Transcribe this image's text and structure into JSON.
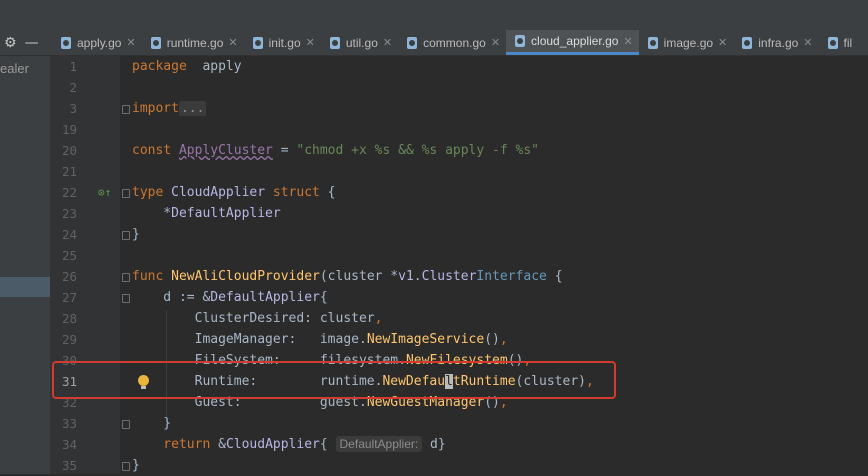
{
  "tabs": [
    {
      "label": "apply.go",
      "active": false
    },
    {
      "label": "runtime.go",
      "active": false
    },
    {
      "label": "init.go",
      "active": false
    },
    {
      "label": "util.go",
      "active": false
    },
    {
      "label": "common.go",
      "active": false
    },
    {
      "label": "cloud_applier.go",
      "active": true
    },
    {
      "label": "image.go",
      "active": false
    },
    {
      "label": "infra.go",
      "active": false
    },
    {
      "label": "fil",
      "active": false
    }
  ],
  "sidebar": {
    "fragment": "ealer"
  },
  "editor": {
    "lines": [
      {
        "num": "1",
        "segments": [
          [
            "kw",
            "package"
          ],
          [
            "",
            "  apply"
          ]
        ]
      },
      {
        "num": "2",
        "segments": []
      },
      {
        "num": "3",
        "fold": true,
        "segments": [
          [
            "kw",
            "import"
          ],
          [
            "",
            ""
          ],
          [
            "foldtxt",
            "..."
          ]
        ]
      },
      {
        "num": "19",
        "segments": []
      },
      {
        "num": "20",
        "segments": [
          [
            "kw",
            "const"
          ],
          [
            "",
            " "
          ],
          [
            "cst",
            "ApplyCluster"
          ],
          [
            "",
            " = "
          ],
          [
            "str",
            "\"chmod +x %s && %s apply -f %s\""
          ]
        ]
      },
      {
        "num": "21",
        "segments": []
      },
      {
        "num": "22",
        "fold": true,
        "impl": "⊙↑",
        "segments": [
          [
            "kw",
            "type"
          ],
          [
            "",
            " "
          ],
          [
            "typ",
            "CloudApplier"
          ],
          [
            "",
            " "
          ],
          [
            "kw",
            "struct"
          ],
          [
            "",
            " {"
          ]
        ]
      },
      {
        "num": "23",
        "segments": [
          [
            "",
            "    *"
          ],
          [
            "typ",
            "DefaultApplier"
          ]
        ]
      },
      {
        "num": "24",
        "fold": true,
        "segments": [
          [
            "",
            "}"
          ]
        ]
      },
      {
        "num": "25",
        "segments": []
      },
      {
        "num": "26",
        "fold": true,
        "segments": [
          [
            "kw",
            "func"
          ],
          [
            "",
            " "
          ],
          [
            "fn",
            "NewAliCloudProvider"
          ],
          [
            "",
            "(cluster *"
          ],
          [
            "typ",
            "v1"
          ],
          [
            "",
            "."
          ],
          [
            "typ",
            "Cluster"
          ],
          [
            ") "
          ],
          [
            "iface",
            "Interface"
          ],
          [
            "",
            " {"
          ]
        ]
      },
      {
        "num": "27",
        "fold": true,
        "segments": [
          [
            "",
            "    d := &"
          ],
          [
            "typ",
            "DefaultApplier"
          ],
          [
            "",
            "{"
          ]
        ]
      },
      {
        "num": "28",
        "segments": [
          [
            "",
            "        ClusterDesired: cluster"
          ],
          [
            "kw",
            ","
          ]
        ]
      },
      {
        "num": "29",
        "segments": [
          [
            "",
            "        ImageManager:   image."
          ],
          [
            "fn",
            "NewImageService"
          ],
          [
            "",
            "()"
          ],
          [
            "kw",
            ","
          ]
        ]
      },
      {
        "num": "30",
        "segments": [
          [
            "",
            "        FileSystem:     filesystem."
          ],
          [
            "fn",
            "NewFilesystem"
          ],
          [
            "",
            "()"
          ],
          [
            "kw",
            ","
          ]
        ]
      },
      {
        "num": "31",
        "current": true,
        "bulb": true,
        "segments": [
          [
            "",
            "        Runtime:        runtime."
          ],
          [
            "fn",
            "NewDefau"
          ],
          [
            "caret",
            "l"
          ],
          [
            "fn",
            "tRuntime"
          ],
          [
            "",
            "(cluster)"
          ],
          [
            "kw",
            ","
          ]
        ]
      },
      {
        "num": "32",
        "segments": [
          [
            "",
            "        Guest:          guest."
          ],
          [
            "fn",
            "NewGuestManager"
          ],
          [
            "",
            "()"
          ],
          [
            "kw",
            ","
          ]
        ]
      },
      {
        "num": "33",
        "fold": true,
        "segments": [
          [
            "",
            "    }"
          ]
        ]
      },
      {
        "num": "34",
        "segments": [
          [
            "kw",
            "    return"
          ],
          [
            "",
            " &"
          ],
          [
            "typ",
            "CloudApplier"
          ],
          [
            "",
            "{ "
          ],
          [
            "hint",
            "DefaultApplier:"
          ],
          [
            "",
            " d}"
          ]
        ]
      },
      {
        "num": "35",
        "fold": true,
        "segments": [
          [
            "",
            "}"
          ]
        ]
      }
    ]
  },
  "icons": {
    "settings": "gear-icon",
    "minimize": "minus-icon",
    "file": "go-file-icon",
    "close": "close-icon",
    "bulb": "lightbulb-icon"
  },
  "colors": {
    "highlight_box": "#d43b30",
    "active_tab_underline": "#4a88c7",
    "keyword": "#cc7832",
    "string": "#6a8759",
    "function": "#ffc66d"
  }
}
